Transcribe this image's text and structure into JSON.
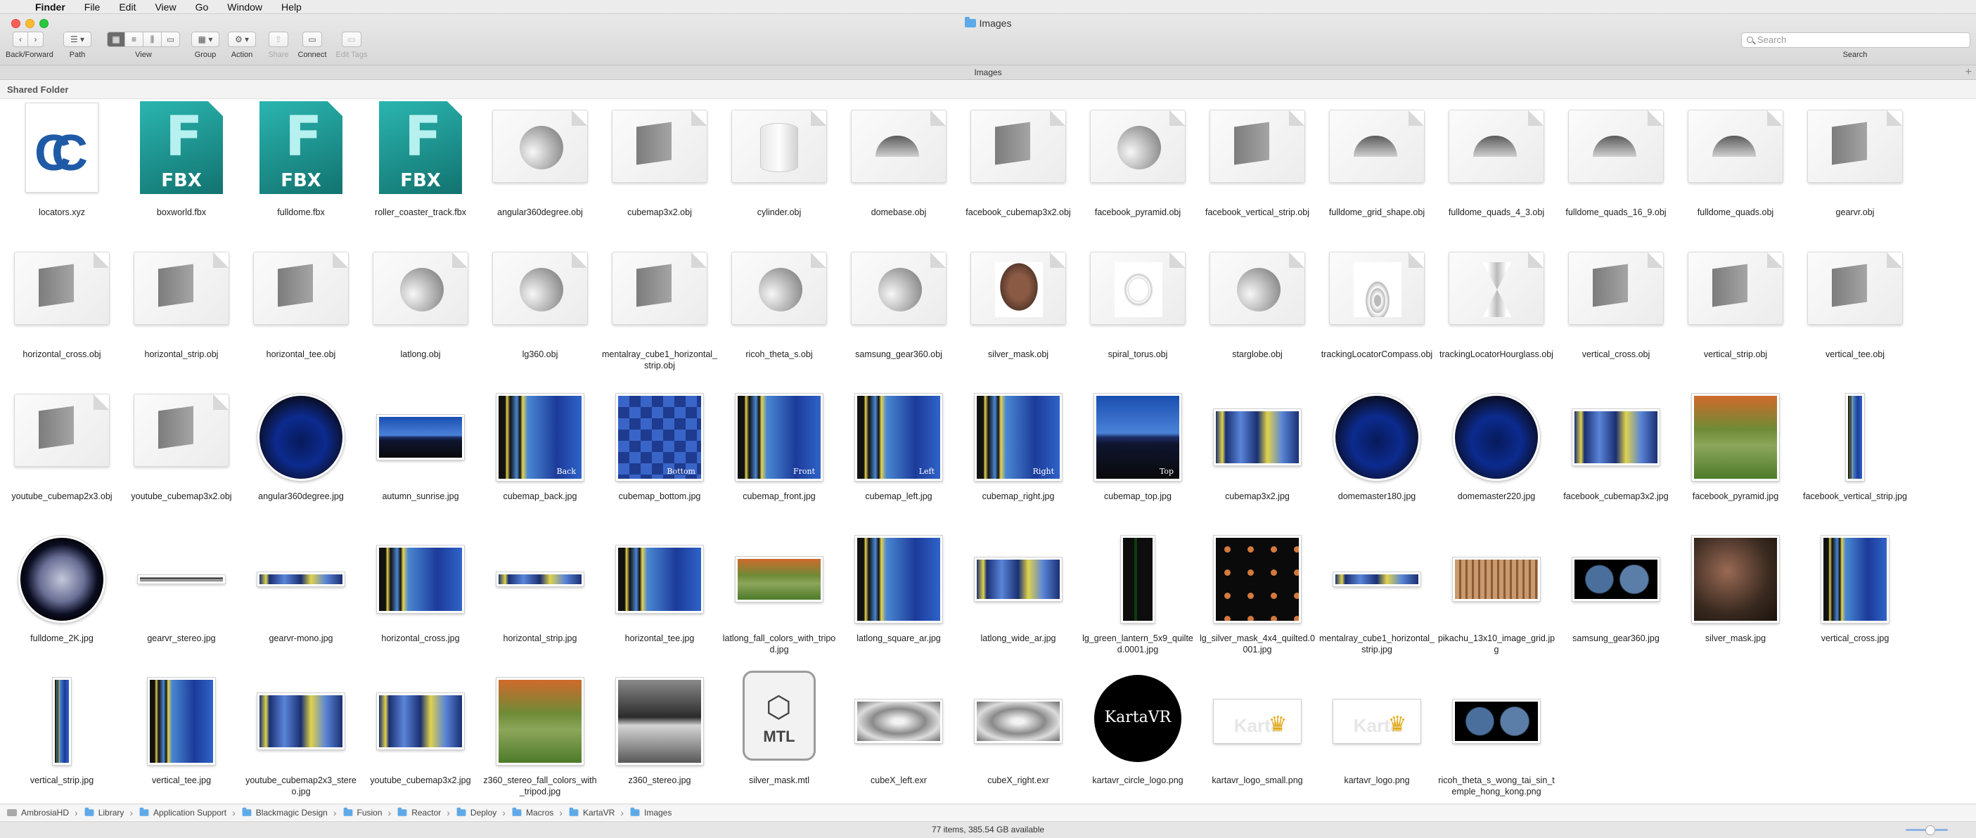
{
  "menubar": {
    "app": "Finder",
    "items": [
      "File",
      "Edit",
      "View",
      "Go",
      "Window",
      "Help"
    ]
  },
  "window": {
    "title": "Images"
  },
  "toolbar": {
    "back_forward": "Back/Forward",
    "path": "Path",
    "view": "View",
    "group": "Group",
    "action": "Action",
    "share": "Share",
    "connect": "Connect",
    "edit_tags": "Edit Tags",
    "search_label": "Search",
    "search_placeholder": "Search"
  },
  "tab": {
    "title": "Images"
  },
  "sidebar_section": "Shared Folder",
  "files": [
    {
      "name": "locators.xyz",
      "kind": "xyz"
    },
    {
      "name": "boxworld.fbx",
      "kind": "fbx"
    },
    {
      "name": "fulldome.fbx",
      "kind": "fbx"
    },
    {
      "name": "roller_coaster_track.fbx",
      "kind": "fbx"
    },
    {
      "name": "angular360degree.obj",
      "kind": "obj-sphere"
    },
    {
      "name": "cubemap3x2.obj",
      "kind": "obj-square"
    },
    {
      "name": "cylinder.obj",
      "kind": "obj-cylinder"
    },
    {
      "name": "domebase.obj",
      "kind": "obj-dome"
    },
    {
      "name": "facebook_cubemap3x2.obj",
      "kind": "obj-square"
    },
    {
      "name": "facebook_pyramid.obj",
      "kind": "obj-sphere"
    },
    {
      "name": "facebook_vertical_strip.obj",
      "kind": "obj-square"
    },
    {
      "name": "fulldome_grid_shape.obj",
      "kind": "obj-dome"
    },
    {
      "name": "fulldome_quads_4_3.obj",
      "kind": "obj-dome"
    },
    {
      "name": "fulldome_quads_16_9.obj",
      "kind": "obj-dome"
    },
    {
      "name": "fulldome_quads.obj",
      "kind": "obj-dome"
    },
    {
      "name": "gearvr.obj",
      "kind": "obj-square"
    },
    {
      "name": "horizontal_cross.obj",
      "kind": "obj-square"
    },
    {
      "name": "horizontal_strip.obj",
      "kind": "obj-square"
    },
    {
      "name": "horizontal_tee.obj",
      "kind": "obj-square"
    },
    {
      "name": "latlong.obj",
      "kind": "obj-sphere"
    },
    {
      "name": "lg360.obj",
      "kind": "obj-sphere"
    },
    {
      "name": "mentalray_cube1_horizontal_strip.obj",
      "kind": "obj-square"
    },
    {
      "name": "ricoh_theta_s.obj",
      "kind": "obj-sphere"
    },
    {
      "name": "samsung_gear360.obj",
      "kind": "obj-sphere"
    },
    {
      "name": "silver_mask.obj",
      "kind": "mask3d"
    },
    {
      "name": "spiral_torus.obj",
      "kind": "torus"
    },
    {
      "name": "starglobe.obj",
      "kind": "obj-sphere"
    },
    {
      "name": "trackingLocatorCompass.obj",
      "kind": "cone"
    },
    {
      "name": "trackingLocatorHourglass.obj",
      "kind": "hour"
    },
    {
      "name": "vertical_cross.obj",
      "kind": "obj-square"
    },
    {
      "name": "vertical_strip.obj",
      "kind": "obj-square"
    },
    {
      "name": "vertical_tee.obj",
      "kind": "obj-square"
    },
    {
      "name": "youtube_cubemap2x3.obj",
      "kind": "obj-square"
    },
    {
      "name": "youtube_cubemap3x2.obj",
      "kind": "obj-square"
    },
    {
      "name": "angular360degree.jpg",
      "kind": "img",
      "style": "space",
      "shape": "sq"
    },
    {
      "name": "autumn_sunrise.jpg",
      "kind": "img",
      "style": "sky",
      "shape": "wide"
    },
    {
      "name": "cubemap_back.jpg",
      "kind": "img",
      "style": "city",
      "shape": "sq",
      "caption": "Back"
    },
    {
      "name": "cubemap_bottom.jpg",
      "kind": "img",
      "style": "chk",
      "shape": "sq",
      "caption": "Bottom"
    },
    {
      "name": "cubemap_front.jpg",
      "kind": "img",
      "style": "city",
      "shape": "sq",
      "caption": "Front"
    },
    {
      "name": "cubemap_left.jpg",
      "kind": "img",
      "style": "city",
      "shape": "sq",
      "caption": "Left"
    },
    {
      "name": "cubemap_right.jpg",
      "kind": "img",
      "style": "city",
      "shape": "sq",
      "caption": "Right"
    },
    {
      "name": "cubemap_top.jpg",
      "kind": "img",
      "style": "sky",
      "shape": "sq",
      "caption": "Top"
    },
    {
      "name": "cubemap3x2.jpg",
      "kind": "img",
      "style": "wide",
      "shape": "r32"
    },
    {
      "name": "domemaster180.jpg",
      "kind": "img",
      "style": "space",
      "shape": "sq"
    },
    {
      "name": "domemaster220.jpg",
      "kind": "img",
      "style": "space",
      "shape": "sq"
    },
    {
      "name": "facebook_cubemap3x2.jpg",
      "kind": "img",
      "style": "wide",
      "shape": "r32"
    },
    {
      "name": "facebook_pyramid.jpg",
      "kind": "img",
      "style": "forest",
      "shape": "sq"
    },
    {
      "name": "facebook_vertical_strip.jpg",
      "kind": "img",
      "style": "city",
      "shape": "vstrip"
    },
    {
      "name": "fulldome_2K.jpg",
      "kind": "img",
      "style": "dark",
      "shape": "sq"
    },
    {
      "name": "gearvr_stereo.jpg",
      "kind": "img",
      "style": "bw",
      "shape": "thin"
    },
    {
      "name": "gearvr-mono.jpg",
      "kind": "img",
      "style": "wide",
      "shape": "strip"
    },
    {
      "name": "horizontal_cross.jpg",
      "kind": "img",
      "style": "city",
      "shape": "r43"
    },
    {
      "name": "horizontal_strip.jpg",
      "kind": "img",
      "style": "wide",
      "shape": "strip"
    },
    {
      "name": "horizontal_tee.jpg",
      "kind": "img",
      "style": "city",
      "shape": "r43"
    },
    {
      "name": "latlong_fall_colors_with_tripod.jpg",
      "kind": "img",
      "style": "forest",
      "shape": "wide"
    },
    {
      "name": "latlong_square_ar.jpg",
      "kind": "img",
      "style": "city",
      "shape": "sq"
    },
    {
      "name": "latlong_wide_ar.jpg",
      "kind": "img",
      "style": "wide",
      "shape": "r21"
    },
    {
      "name": "lg_green_lantern_5x9_quilted.0001.jpg",
      "kind": "img",
      "style": "green",
      "shape": "tall"
    },
    {
      "name": "lg_silver_mask_4x4_quilted.0001.jpg",
      "kind": "img",
      "style": "masks",
      "shape": "sq"
    },
    {
      "name": "mentalray_cube1_horizontal_strip.jpg",
      "kind": "img",
      "style": "wide",
      "shape": "strip"
    },
    {
      "name": "pikachu_13x10_image_grid.jpg",
      "kind": "img",
      "style": "pika",
      "shape": "r21"
    },
    {
      "name": "samsung_gear360.jpg",
      "kind": "img",
      "style": "fish",
      "shape": "r21"
    },
    {
      "name": "silver_mask.jpg",
      "kind": "img",
      "style": "silv",
      "shape": "sq"
    },
    {
      "name": "vertical_cross.jpg",
      "kind": "img",
      "style": "city",
      "shape": "tall34"
    },
    {
      "name": "vertical_strip.jpg",
      "kind": "img",
      "style": "city",
      "shape": "vstrip"
    },
    {
      "name": "vertical_tee.jpg",
      "kind": "img",
      "style": "city",
      "shape": "tall34"
    },
    {
      "name": "youtube_cubemap2x3_stereo.jpg",
      "kind": "img",
      "style": "wide",
      "shape": "r32"
    },
    {
      "name": "youtube_cubemap3x2.jpg",
      "kind": "img",
      "style": "wide",
      "shape": "r32"
    },
    {
      "name": "z360_stereo_fall_colors_with_tripod.jpg",
      "kind": "img",
      "style": "forest",
      "shape": "sq"
    },
    {
      "name": "z360_stereo.jpg",
      "kind": "img",
      "style": "bw",
      "shape": "sq"
    },
    {
      "name": "silver_mask.mtl",
      "kind": "mtl",
      "badge": "MTL"
    },
    {
      "name": "cubeX_left.exr",
      "kind": "img",
      "style": "exr",
      "shape": "r21"
    },
    {
      "name": "cubeX_right.exr",
      "kind": "img",
      "style": "exr",
      "shape": "r21"
    },
    {
      "name": "kartavr_circle_logo.png",
      "kind": "kcirc",
      "logo_text": "KartaVR"
    },
    {
      "name": "kartavr_logo_small.png",
      "kind": "img",
      "style": "kvlogo",
      "shape": "r21"
    },
    {
      "name": "kartavr_logo.png",
      "kind": "img",
      "style": "kvlogo",
      "shape": "r21"
    },
    {
      "name": "ricoh_theta_s_wong_tai_sin_temple_hong_kong.png",
      "kind": "img",
      "style": "fish",
      "shape": "r21"
    }
  ],
  "fbx_badge": "FBX",
  "path": [
    "AmbrosiaHD",
    "Library",
    "Application Support",
    "Blackmagic Design",
    "Fusion",
    "Reactor",
    "Deploy",
    "Macros",
    "KartaVR",
    "Images"
  ],
  "status": "77 items, 385.54 GB available",
  "colors": {
    "folder": "#5ea9e8",
    "fbx": "#1a9b96",
    "kartavr_gold": "#e3a914"
  }
}
